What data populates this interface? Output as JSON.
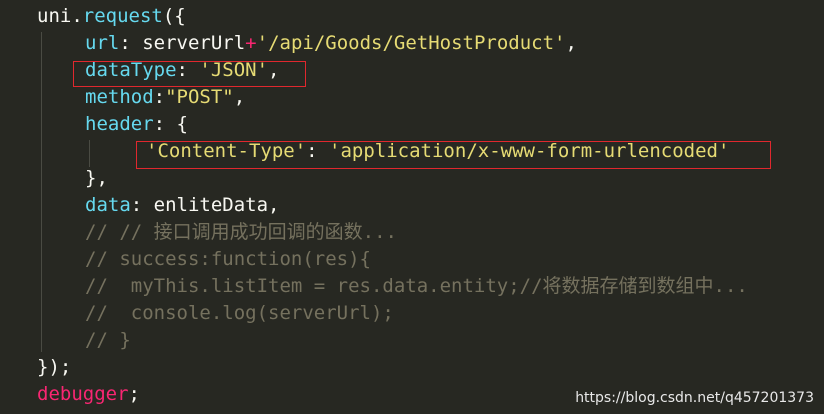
{
  "code": {
    "l1": {
      "obj": "uni",
      "dot": ".",
      "fn": "request",
      "paren": "({"
    },
    "l2": {
      "key": "url",
      "colon": ": ",
      "ident": "serverUrl",
      "op": "+",
      "str": "'/api/Goods/GetHostProduct'",
      "comma": ","
    },
    "l3": {
      "key": "dataType",
      "colon": ": ",
      "str": "'JSON'",
      "comma": ","
    },
    "l4": {
      "key": "method",
      "colon": ":",
      "str": "\"POST\"",
      "comma": ","
    },
    "l5": {
      "key": "header",
      "colon": ": ",
      "brace": "{"
    },
    "l6": {
      "str1": "'Content-Type'",
      "colon": ": ",
      "str2": "'application/x-www-form-urlencoded'"
    },
    "l7": {
      "text": "},"
    },
    "l8": {
      "key": "data",
      "colon": ": ",
      "ident": "enliteData",
      "comma": ","
    },
    "l9": {
      "text": "// // 接口调用成功回调的函数..."
    },
    "l10": {
      "text": "// success:function(res){"
    },
    "l11": {
      "text": "//  myThis.listItem = res.data.entity;//将数据存储到数组中..."
    },
    "l12": {
      "text": "//  console.log(serverUrl);"
    },
    "l13": {
      "text": "// }"
    },
    "l14": {
      "text": "});"
    },
    "l15": {
      "kw": "debugger",
      "semi": ";"
    }
  },
  "watermark": "https://blog.csdn.net/q457201373",
  "colors": {
    "background": "#272822",
    "highlight_box": "#e0282e"
  }
}
